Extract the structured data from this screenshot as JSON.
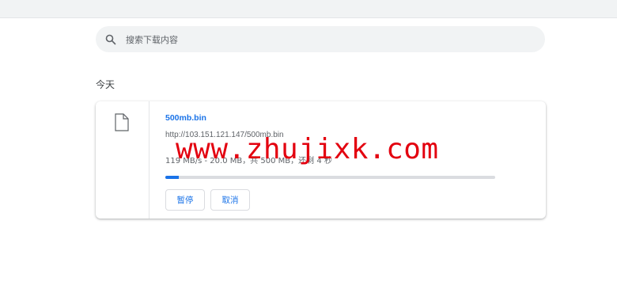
{
  "search": {
    "placeholder": "搜索下载内容",
    "icon": "search-icon"
  },
  "section": {
    "title": "今天"
  },
  "download": {
    "filename": "500mb.bin",
    "url": "http://103.151.121.147/500mb.bin",
    "status": "119 MB/s - 20.0 MB，共 500 MB，还剩 4 秒",
    "progress": 0.04,
    "file_icon": "file-icon",
    "actions": {
      "pause_label": "暂停",
      "cancel_label": "取消"
    }
  },
  "watermark": {
    "text": "www.zhujixk.com"
  },
  "colors": {
    "accent": "#1a73e8",
    "watermark": "#e3000f"
  }
}
